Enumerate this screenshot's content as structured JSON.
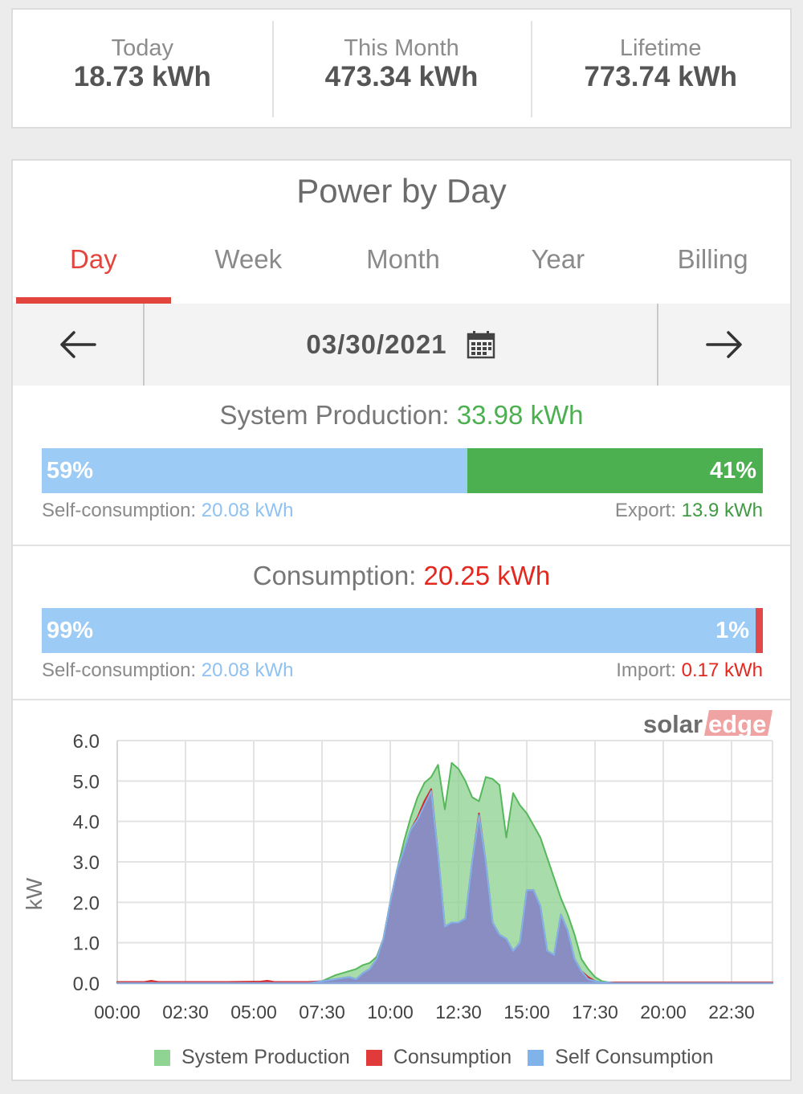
{
  "summary": {
    "items": [
      {
        "label": "Today",
        "value": "18.73 kWh"
      },
      {
        "label": "This Month",
        "value": "473.34 kWh"
      },
      {
        "label": "Lifetime",
        "value": "773.74 kWh"
      }
    ]
  },
  "card": {
    "title": "Power by Day",
    "tabs": [
      {
        "label": "Day",
        "active": true
      },
      {
        "label": "Week",
        "active": false
      },
      {
        "label": "Month",
        "active": false
      },
      {
        "label": "Year",
        "active": false
      },
      {
        "label": "Billing",
        "active": false
      }
    ],
    "date": "03/30/2021",
    "icons": {
      "prev": "arrow-left-icon",
      "next": "arrow-right-icon",
      "calendar": "calendar-icon"
    }
  },
  "production": {
    "label": "System Production:",
    "value": "33.98 kWh",
    "self_pct_value": 59,
    "self_pct": "59%",
    "export_pct": "41%",
    "self_label": "Self-consumption:",
    "self_value": "20.08 kWh",
    "export_label": "Export:",
    "export_value": "13.9 kWh"
  },
  "consumption": {
    "label": "Consumption:",
    "value": "20.25 kWh",
    "self_pct_value": 99,
    "self_pct": "99%",
    "import_pct": "1%",
    "self_label": "Self-consumption:",
    "self_value": "20.08 kWh",
    "import_label": "Import:",
    "import_value": "0.17 kWh"
  },
  "brand": {
    "part1": "solar",
    "part2": "edge"
  },
  "colors": {
    "accent": "#e2453d",
    "production": "#8fd493",
    "consumption": "#e03a3a",
    "self_consumption": "#7fb3ea",
    "export_green": "#4caf50",
    "self_blue": "#9ccbf5"
  },
  "chart_data": {
    "type": "area",
    "ylabel": "kW",
    "ylim": [
      0,
      6
    ],
    "yticks": [
      "0.0",
      "1.0",
      "2.0",
      "3.0",
      "4.0",
      "5.0",
      "6.0"
    ],
    "xlim": [
      0,
      24
    ],
    "xticks": [
      "00:00",
      "02:30",
      "05:00",
      "07:30",
      "10:00",
      "12:30",
      "15:00",
      "17:30",
      "20:00",
      "22:30"
    ],
    "grid": true,
    "legend_position": "bottom",
    "x": [
      0,
      1,
      1.25,
      1.5,
      2,
      4,
      5.25,
      5.5,
      5.75,
      6,
      7,
      7.5,
      8,
      8.5,
      8.75,
      9,
      9.25,
      9.5,
      9.75,
      10,
      10.25,
      10.5,
      10.75,
      11,
      11.25,
      11.5,
      11.75,
      12,
      12.25,
      12.5,
      12.75,
      13,
      13.25,
      13.5,
      13.75,
      14,
      14.25,
      14.5,
      14.75,
      15,
      15.25,
      15.5,
      15.75,
      16,
      16.25,
      16.5,
      16.75,
      17,
      17.25,
      17.5,
      17.75,
      18,
      18.25,
      18.5,
      18.75,
      19,
      19.25,
      19.5,
      20,
      21,
      22,
      23,
      24
    ],
    "series": [
      {
        "name": "System Production",
        "values": [
          0,
          0,
          0,
          0,
          0,
          0,
          0,
          0,
          0,
          0,
          0,
          0.05,
          0.2,
          0.3,
          0.35,
          0.45,
          0.5,
          0.65,
          1.1,
          2.0,
          2.8,
          3.5,
          4.1,
          4.6,
          4.95,
          5.1,
          5.4,
          4.3,
          5.45,
          5.3,
          5.0,
          4.6,
          4.5,
          5.1,
          5.05,
          4.9,
          3.6,
          4.7,
          4.4,
          4.2,
          3.9,
          3.6,
          3.1,
          2.6,
          2.1,
          1.7,
          1.2,
          0.6,
          0.35,
          0.15,
          0.05,
          0.02,
          0,
          0,
          0,
          0,
          0,
          0,
          0,
          0,
          0,
          0,
          0
        ]
      },
      {
        "name": "Consumption",
        "values": [
          0.03,
          0.03,
          0.06,
          0.03,
          0.03,
          0.03,
          0.04,
          0.06,
          0.03,
          0.03,
          0.03,
          0.05,
          0.1,
          0.15,
          0.1,
          0.25,
          0.35,
          0.6,
          1.1,
          2.0,
          2.8,
          3.3,
          3.8,
          4.1,
          4.5,
          4.8,
          3.2,
          1.4,
          1.5,
          1.5,
          1.6,
          3.0,
          4.2,
          3.0,
          1.5,
          1.2,
          1.1,
          0.8,
          1.0,
          2.3,
          2.3,
          1.9,
          0.8,
          0.7,
          1.7,
          1.3,
          0.6,
          0.3,
          0.15,
          0.05,
          0.02,
          0.02,
          0.02,
          0.02,
          0.02,
          0.02,
          0.02,
          0.02,
          0.02,
          0.02,
          0.02,
          0.02,
          0.02
        ]
      },
      {
        "name": "Self Consumption",
        "values": [
          0,
          0,
          0,
          0,
          0,
          0,
          0,
          0,
          0,
          0,
          0,
          0.05,
          0.1,
          0.15,
          0.1,
          0.25,
          0.35,
          0.6,
          1.1,
          2.0,
          2.8,
          3.3,
          3.8,
          4.05,
          4.4,
          4.75,
          3.2,
          1.4,
          1.5,
          1.5,
          1.6,
          3.0,
          4.15,
          3.0,
          1.5,
          1.2,
          1.1,
          0.8,
          1.0,
          2.3,
          2.3,
          1.9,
          0.8,
          0.7,
          1.7,
          1.3,
          0.6,
          0.3,
          0.1,
          0.05,
          0.02,
          0.02,
          0,
          0,
          0,
          0,
          0,
          0,
          0,
          0,
          0,
          0,
          0
        ]
      }
    ]
  }
}
